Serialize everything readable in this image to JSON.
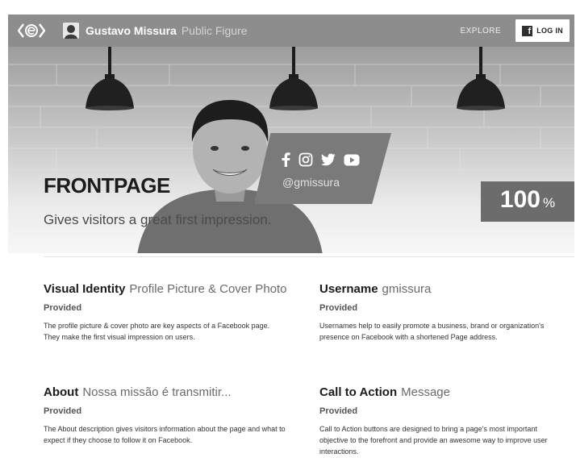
{
  "header": {
    "page_name": "Gustavo Missura",
    "page_category": "Public Figure",
    "explore_label": "EXPLORE",
    "login_label": "LOG IN"
  },
  "hero": {
    "title": "FRONTPAGE",
    "subtitle": "Gives visitors a great first impression.",
    "handle": "@gmissura",
    "score_value": "100",
    "score_unit": "%",
    "social_icons": [
      "facebook-icon",
      "instagram-icon",
      "twitter-icon",
      "youtube-icon"
    ]
  },
  "cards": [
    {
      "title": "Visual Identity",
      "value": "Profile Picture & Cover Photo",
      "status": "Provided",
      "description": "The profile picture & cover photo are key aspects of a Facebook page. They make the first visual impression on users."
    },
    {
      "title": "Username",
      "value": "gmissura",
      "status": "Provided",
      "description": "Usernames help to easily promote a business, brand or organization's presence on Facebook with a shortened Page address."
    },
    {
      "title": "About",
      "value": "Nossa missão é transmitir...",
      "status": "Provided",
      "description": "The About description gives visitors information about the page and what to expect if they choose to follow it on Facebook."
    },
    {
      "title": "Call to Action",
      "value": "Message",
      "status": "Provided",
      "description": "Call to Action buttons are designed to bring a page's most important objective to the forefront and provide an awesome way to improve user interactions."
    }
  ],
  "colors": {
    "topbar": "#8d8d8d",
    "score_badge": "#6c6c6c",
    "banner": "#7a7a7a"
  }
}
